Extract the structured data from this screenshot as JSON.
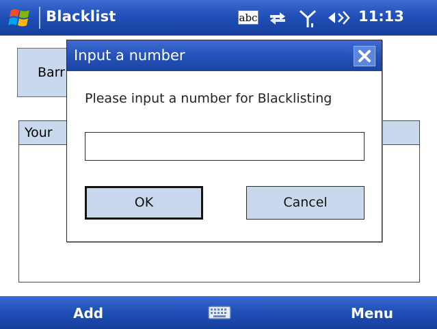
{
  "titlebar": {
    "title": "Blacklist",
    "time": "11:13",
    "input_indicator": "abc",
    "icons": [
      "windows-start-icon",
      "input-method-icon",
      "connectivity-icon",
      "signal-icon",
      "volume-icon"
    ]
  },
  "background_form": {
    "button_label": "Barr",
    "list_header": "Your"
  },
  "dialog": {
    "title": "Input a number",
    "prompt": "Please input a number for Blacklisting",
    "input_value": "",
    "input_placeholder": "",
    "ok_label": "OK",
    "cancel_label": "Cancel"
  },
  "softkeys": {
    "left": "Add",
    "right": "Menu"
  },
  "colors": {
    "bar_blue": "#2050b8",
    "button_fill": "#c9d8ec"
  }
}
